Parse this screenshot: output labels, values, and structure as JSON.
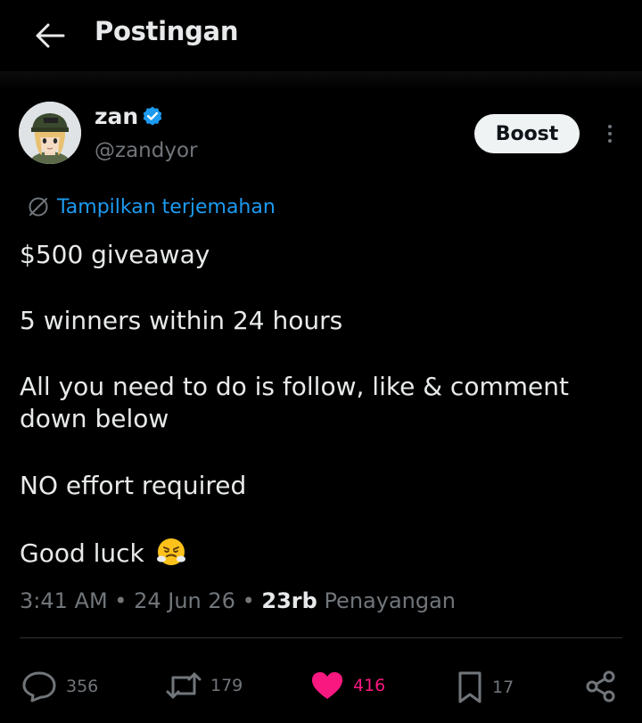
{
  "header": {
    "title": "Postingan"
  },
  "author": {
    "display_name": "zan",
    "handle": "@zandyor",
    "verified": true
  },
  "boost_label": "Boost",
  "translate_label": "Tampilkan terjemahan",
  "post": {
    "line1": "$500 giveaway",
    "line2": "5 winners within 24 hours",
    "line3a": "All you need to do is follow, like & comment",
    "line3b": "down below",
    "line4": "NO effort required",
    "line5": "Good luck"
  },
  "meta": {
    "time": "3:41 AM",
    "date": "24 Jun 26",
    "views_count": "23rb",
    "views_label": "Penayangan"
  },
  "actions": {
    "replies": "356",
    "reposts": "179",
    "likes": "416",
    "bookmarks": "17"
  },
  "colors": {
    "background": "#000000",
    "text": "#e7e9ea",
    "muted": "#71767b",
    "link": "#1d9bf0",
    "like": "#f91880",
    "verified": "#1d9bf0"
  }
}
